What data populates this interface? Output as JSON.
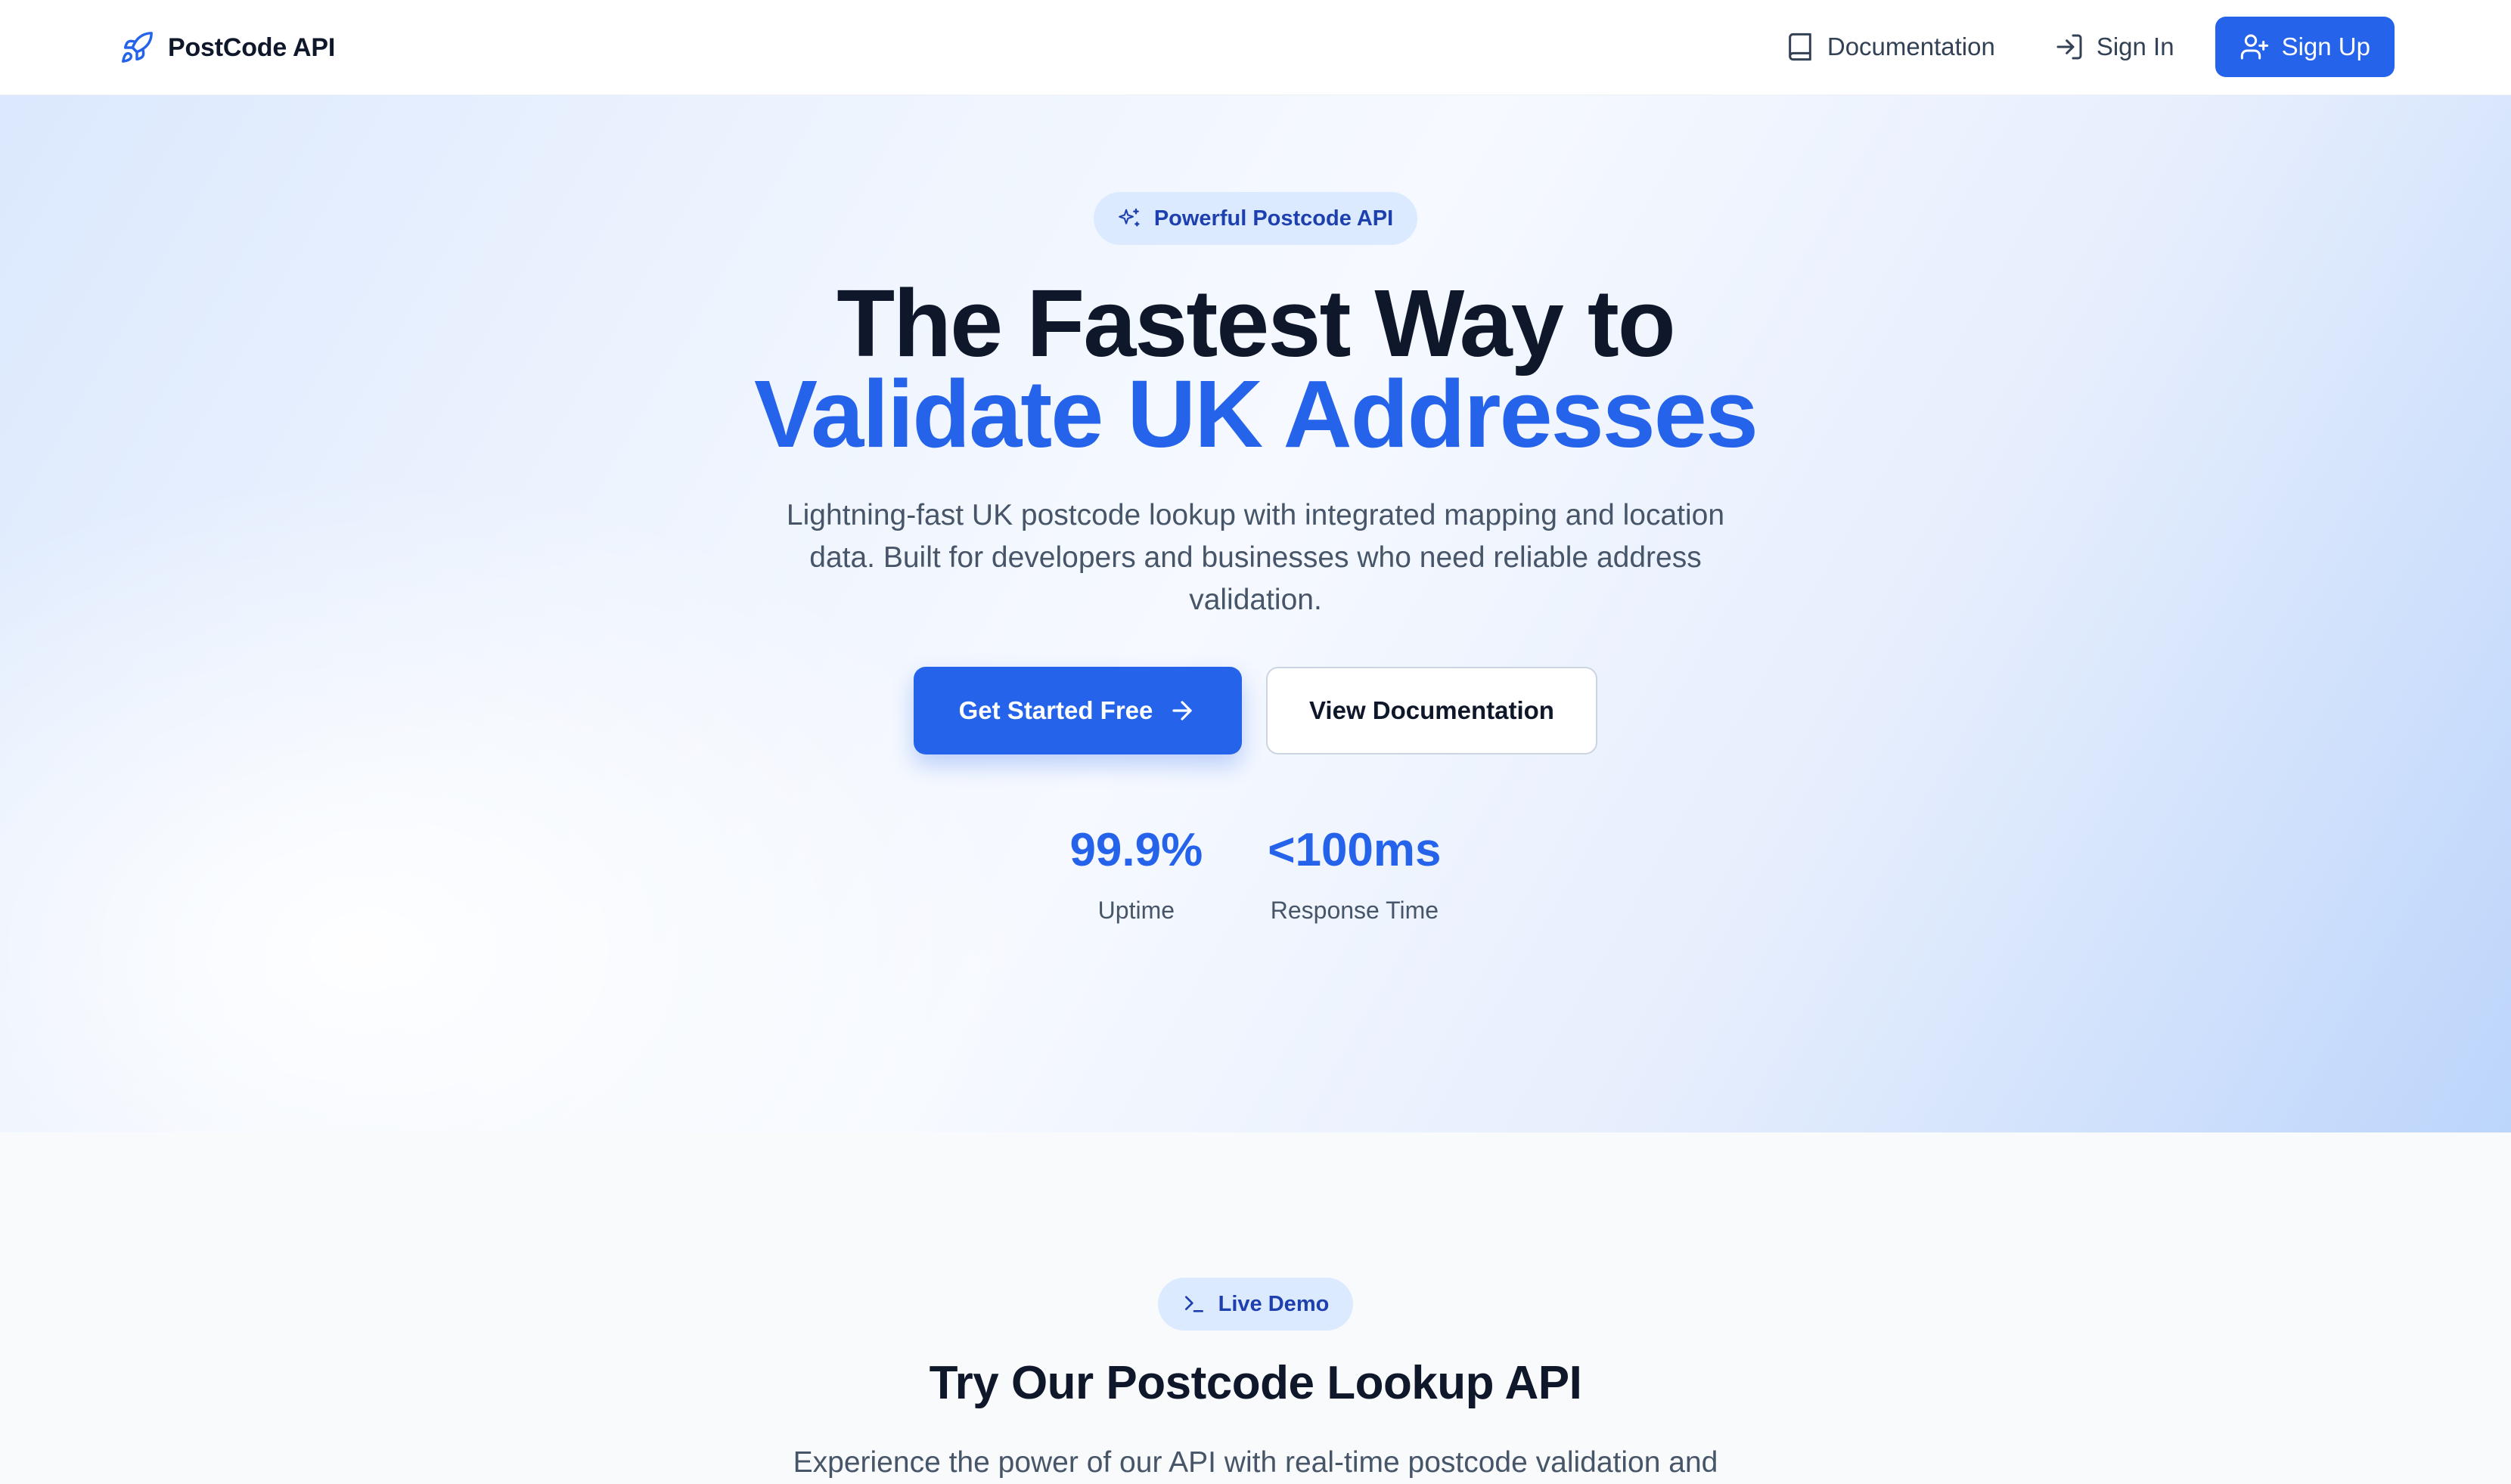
{
  "nav": {
    "brand": "PostCode API",
    "links": [
      {
        "label": "Documentation",
        "icon": "book-icon"
      },
      {
        "label": "Sign In",
        "icon": "sign-in-icon"
      }
    ],
    "signup": {
      "label": "Sign Up",
      "icon": "user-plus-icon"
    }
  },
  "hero": {
    "badge": "Powerful Postcode API",
    "badge_icon": "sparkles-icon",
    "title_line1": "The Fastest Way to",
    "title_line2": "Validate UK Addresses",
    "subtitle": "Lightning-fast UK postcode lookup with integrated mapping and location data. Built for developers and businesses who need reliable address validation.",
    "primary_cta": "Get Started Free",
    "secondary_cta": "View Documentation",
    "stats": [
      {
        "value": "99.9%",
        "label": "Uptime"
      },
      {
        "value": "<100ms",
        "label": "Response Time"
      }
    ]
  },
  "demo": {
    "badge": "Live Demo",
    "badge_icon": "terminal-icon",
    "title": "Try Our Postcode Lookup API",
    "subtitle": "Experience the power of our API with real-time postcode validation and"
  },
  "colors": {
    "accent": "#2563eb",
    "text_dark": "#0f172a",
    "text_muted": "#475569",
    "badge_bg": "#dbeafe"
  }
}
